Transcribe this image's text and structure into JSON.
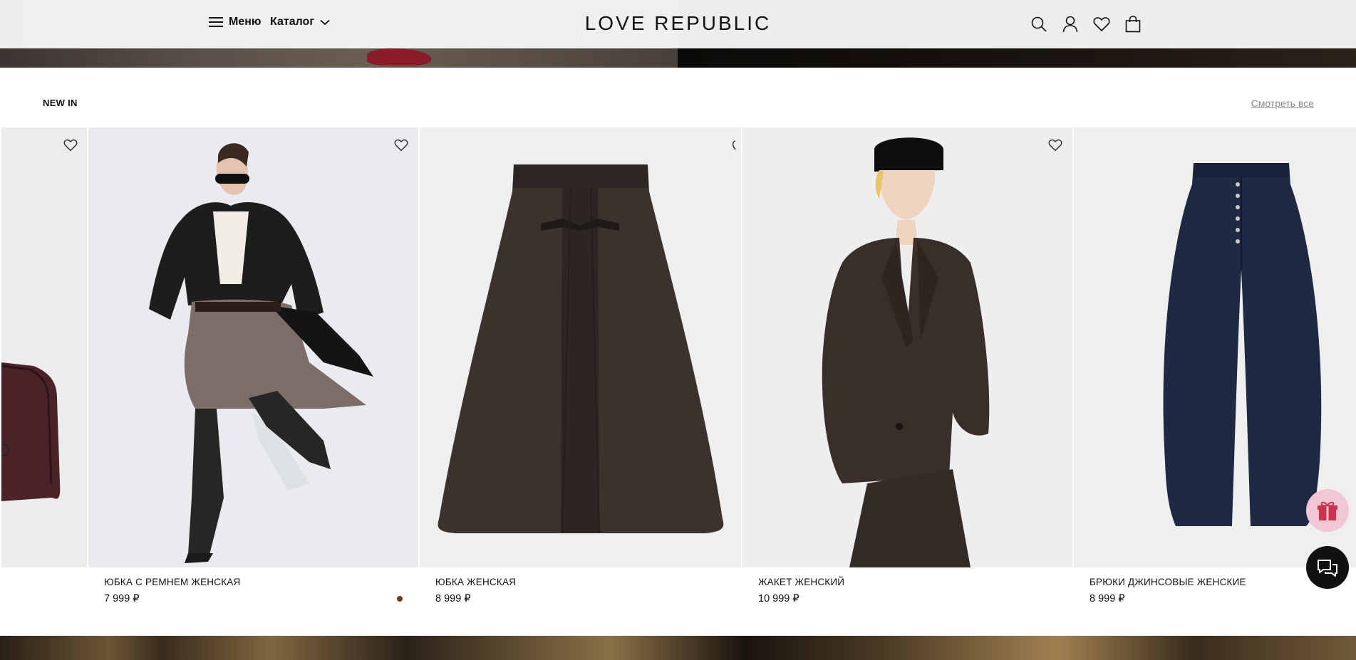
{
  "header": {
    "menu_label": "Меню",
    "catalog_label": "Каталог",
    "logo_text": "LOVE REPUBLIC",
    "icons": [
      "search-icon",
      "user-icon",
      "heart-icon",
      "bag-icon"
    ]
  },
  "section": {
    "title": "NEW IN",
    "see_all": "Смотреть все"
  },
  "products": [
    {
      "name": "ЮБКА С РЕМНЕМ ЖЕНСКАЯ",
      "price": "7 999 ₽",
      "image": "model-leather-jacket-skirt-boots",
      "has_swatch": true
    },
    {
      "name": "ЮБКА ЖЕНСКАЯ",
      "price": "8 999 ₽",
      "image": "brown-faux-leather-a-line-skirt"
    },
    {
      "name": "ЖАКЕТ ЖЕНСКИЙ",
      "price": "10 999 ₽",
      "image": "model-pinstripe-blazer-black-hat"
    },
    {
      "name": "БРЮКИ ДЖИНСОВЫЕ ЖЕНСКИЕ",
      "price": "8 999 ₽",
      "image": "dark-denim-barrel-jeans"
    }
  ],
  "colors": {
    "accent": "#111111",
    "swatch": "#6b3a1e",
    "gift_bg": "#f3c6d6",
    "gift_icon": "#c8334d",
    "see_all": "#8a8a8a"
  }
}
